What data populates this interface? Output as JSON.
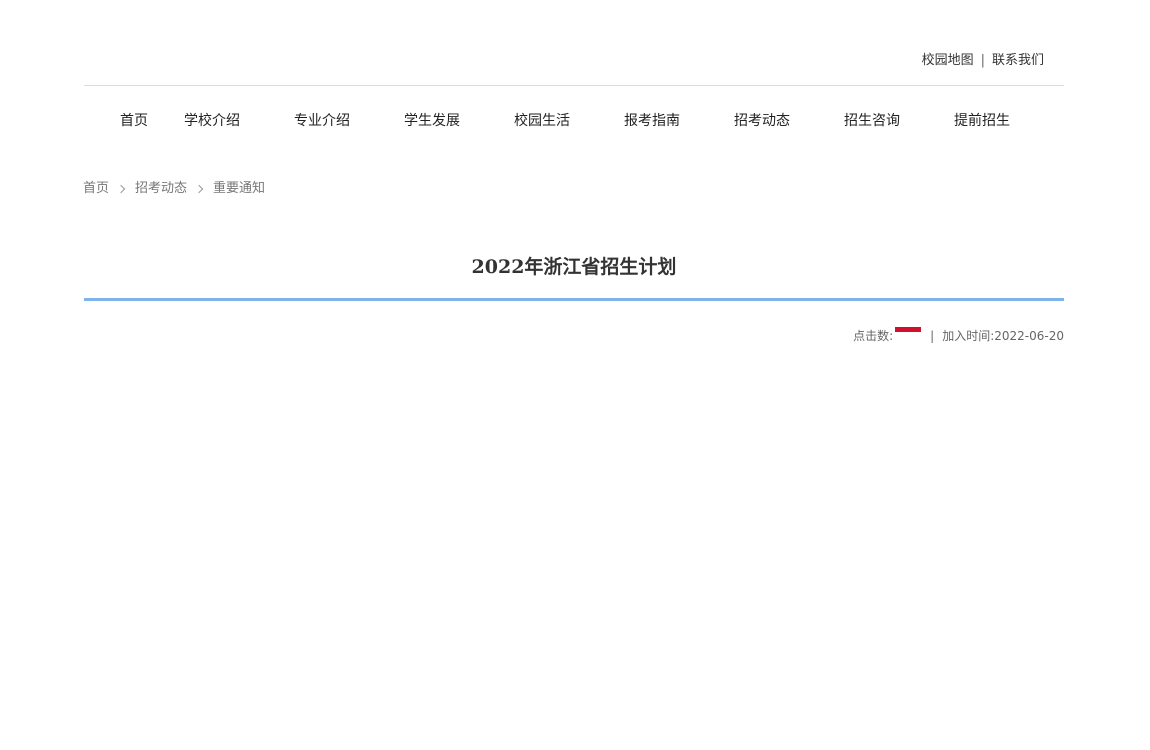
{
  "top_links": {
    "sitemap": "校园地图",
    "separator": "|",
    "contact": "联系我们"
  },
  "nav": {
    "items": [
      "首页",
      "学校介绍",
      "专业介绍",
      "学生发展",
      "校园生活",
      "报考指南",
      "招考动态",
      "招生咨询",
      "提前招生"
    ]
  },
  "breadcrumb": {
    "home": "首页",
    "section": "招考动态",
    "current": "重要通知"
  },
  "article": {
    "title": "2022年浙江省招生计划",
    "hits_label": "点击数:",
    "separator": "|",
    "date_label": "加入时间:",
    "date": "2022-06-20"
  },
  "colors": {
    "title_rule": "#7fb4ea",
    "hits_bar": "#d0102c"
  }
}
